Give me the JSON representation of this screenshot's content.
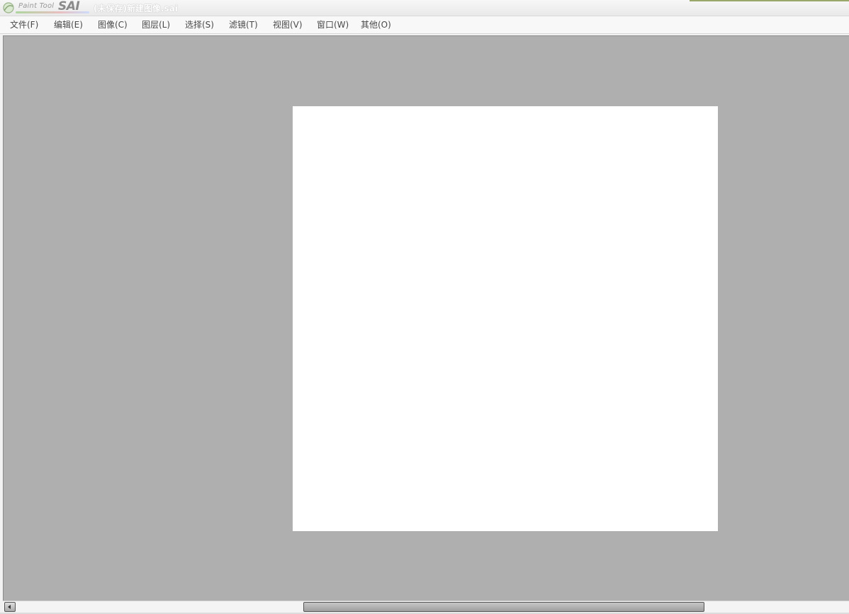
{
  "app": {
    "logo_small": "Paint Tool",
    "logo_big": "SAI",
    "document_title": "(未保存)新建图像.sai"
  },
  "menu": [
    {
      "label": "文件(F)"
    },
    {
      "label": "编辑(E)"
    },
    {
      "label": "图像(C)"
    },
    {
      "label": "图层(L)"
    },
    {
      "label": "选择(S)"
    },
    {
      "label": "滤镜(T)"
    },
    {
      "label": "视图(V)"
    },
    {
      "label": "窗口(W)"
    },
    {
      "label": "其他(O)"
    }
  ],
  "colors": {
    "workspace": "#afafaf",
    "canvas": "#ffffff",
    "titlebar": "#eeeeee",
    "menubar": "#f8f8f8"
  },
  "icons": {
    "logo": "paint-tool-sai-logo-icon",
    "scroll_left": "scroll-left-arrow-icon"
  }
}
